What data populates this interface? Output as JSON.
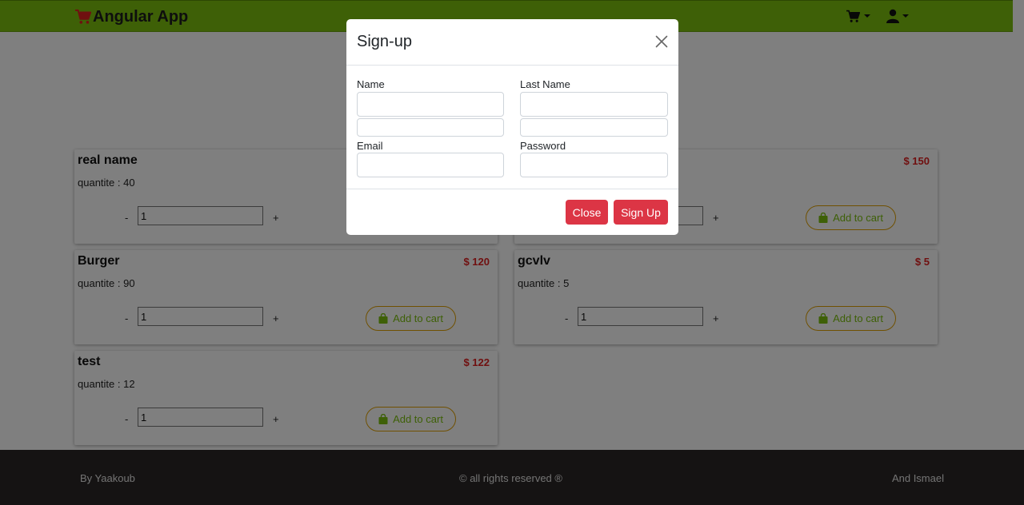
{
  "navbar": {
    "brand": "Angular App",
    "brand_color": "#7cc00e",
    "icons": [
      "cart-icon",
      "user-icon"
    ]
  },
  "products": [
    {
      "name": "real name",
      "price": "",
      "quantity": "quantite : 40",
      "qty_value": "1",
      "add_label": "Add to cart"
    },
    {
      "name": "",
      "price": "$ 150",
      "quantity": "",
      "qty_value": "",
      "add_label": "Add to cart"
    },
    {
      "name": "Burger",
      "price": "$ 120",
      "quantity": "quantite : 90",
      "qty_value": "1",
      "add_label": "Add to cart"
    },
    {
      "name": "gcvlv",
      "price": "$ 5",
      "quantity": "quantite : 5",
      "qty_value": "1",
      "add_label": "Add to cart"
    },
    {
      "name": "test",
      "price": "$ 122",
      "quantity": "quantite : 12",
      "qty_value": "1",
      "add_label": "Add to cart"
    }
  ],
  "stepper": {
    "minus": "-",
    "plus": "+"
  },
  "footer": {
    "left": "By Yaakoub",
    "middle": "© all rights reserved ®",
    "right": "And Ismael"
  },
  "modal": {
    "title": "Sign-up",
    "name_label": "Name",
    "lastname_label": "Last Name",
    "email_label": "Email",
    "password_label": "Password",
    "name_value": "",
    "lastname_value": "",
    "email_value": "",
    "password_value": "",
    "close_label": "Close",
    "signup_label": "Sign Up",
    "button_color": "#dc3545"
  }
}
